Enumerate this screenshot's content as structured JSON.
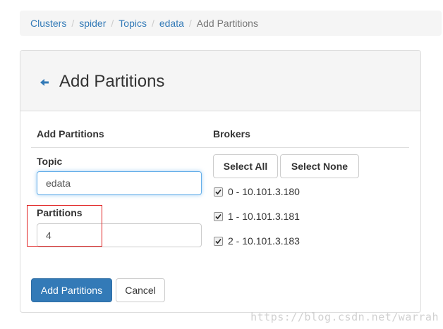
{
  "breadcrumb": {
    "items": [
      "Clusters",
      "spider",
      "Topics",
      "edata"
    ],
    "active": "Add Partitions",
    "separator": "/"
  },
  "panel": {
    "title": "Add Partitions",
    "back_icon": "arrow-left-icon"
  },
  "form": {
    "left_header": "Add Partitions",
    "right_header": "Brokers",
    "topic_label": "Topic",
    "topic_value": "edata",
    "partitions_label": "Partitions",
    "partitions_value": "4"
  },
  "brokers": {
    "select_all_label": "Select All",
    "select_none_label": "Select None",
    "items": [
      {
        "label": "0 - 10.101.3.180",
        "checked": true
      },
      {
        "label": "1 - 10.101.3.181",
        "checked": true
      },
      {
        "label": "2 - 10.101.3.183",
        "checked": true
      }
    ]
  },
  "actions": {
    "submit_label": "Add Partitions",
    "cancel_label": "Cancel"
  },
  "watermark": "https://blog.csdn.net/warrah",
  "colors": {
    "link": "#337ab7",
    "primary": "#337ab7",
    "highlight": "#e02020"
  }
}
